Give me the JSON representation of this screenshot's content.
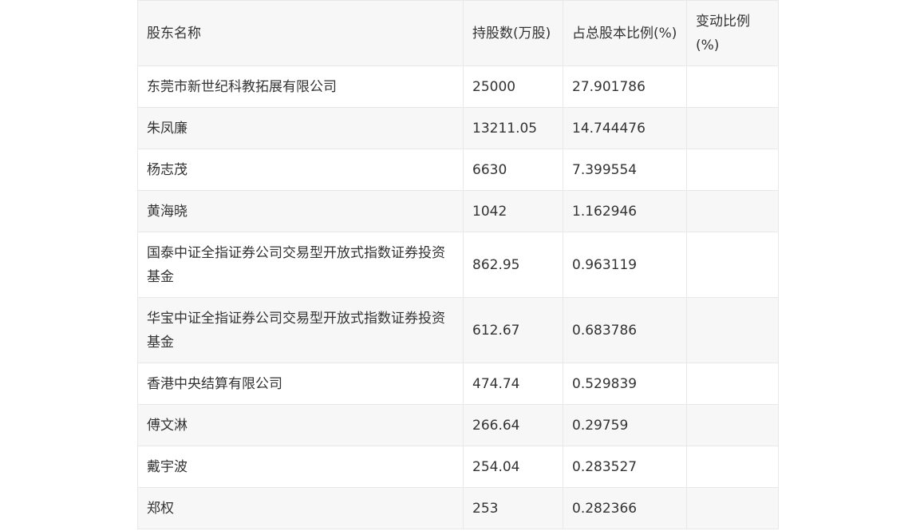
{
  "table": {
    "headers": [
      "股东名称",
      "持股数(万股)",
      "占总股本比例(%)",
      "变动比例(%)"
    ],
    "rows": [
      {
        "name": "东莞市新世纪科教拓展有限公司",
        "shares": "25000",
        "ratio": "27.901786",
        "change": ""
      },
      {
        "name": "朱凤廉",
        "shares": "13211.05",
        "ratio": "14.744476",
        "change": ""
      },
      {
        "name": "杨志茂",
        "shares": "6630",
        "ratio": "7.399554",
        "change": ""
      },
      {
        "name": "黄海晓",
        "shares": "1042",
        "ratio": "1.162946",
        "change": ""
      },
      {
        "name": "国泰中证全指证券公司交易型开放式指数证券投资基金",
        "shares": "862.95",
        "ratio": "0.963119",
        "change": ""
      },
      {
        "name": "华宝中证全指证券公司交易型开放式指数证券投资基金",
        "shares": "612.67",
        "ratio": "0.683786",
        "change": ""
      },
      {
        "name": "香港中央结算有限公司",
        "shares": "474.74",
        "ratio": "0.529839",
        "change": ""
      },
      {
        "name": "傅文淋",
        "shares": "266.64",
        "ratio": "0.29759",
        "change": ""
      },
      {
        "name": "戴宇波",
        "shares": "254.04",
        "ratio": "0.283527",
        "change": ""
      },
      {
        "name": "郑权",
        "shares": "253",
        "ratio": "0.282366",
        "change": ""
      }
    ]
  }
}
